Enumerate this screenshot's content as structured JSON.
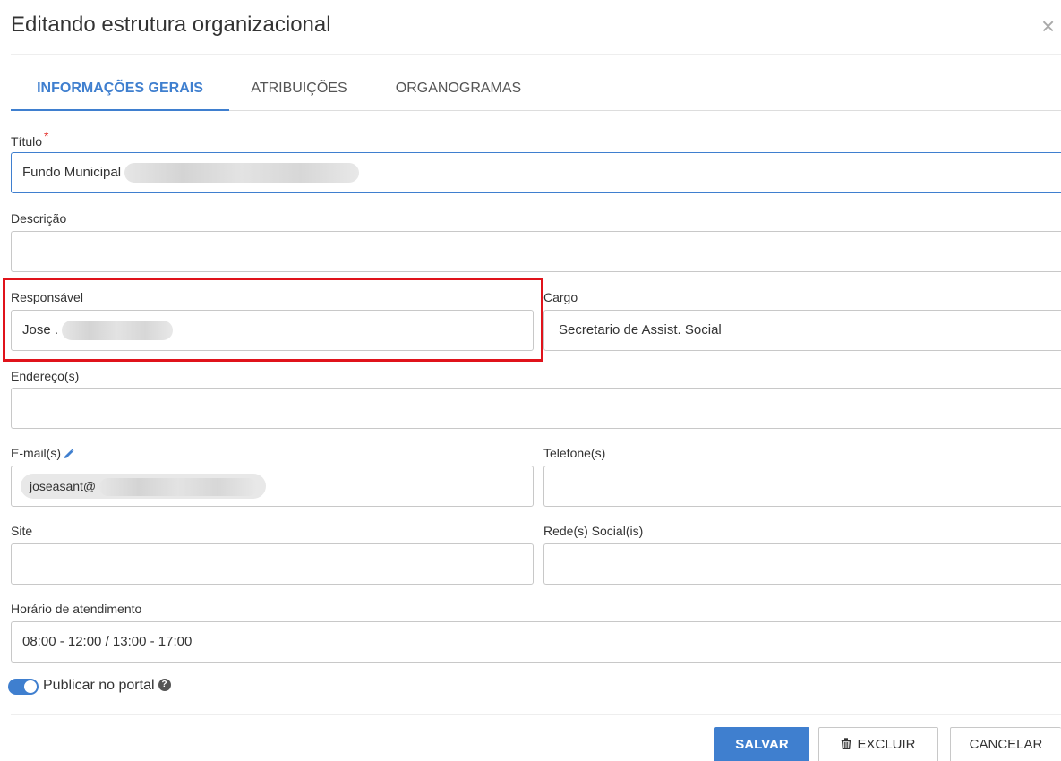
{
  "modal": {
    "title": "Editando estrutura organizacional",
    "close_symbol": "×"
  },
  "tabs": [
    {
      "label": "INFORMAÇÕES GERAIS",
      "active": true
    },
    {
      "label": "ATRIBUIÇÕES",
      "active": false
    },
    {
      "label": "ORGANOGRAMAS",
      "active": false
    }
  ],
  "form": {
    "titulo": {
      "label": "Título",
      "required_mark": "*",
      "value": "Fundo Municipal"
    },
    "descricao": {
      "label": "Descrição",
      "value": ""
    },
    "responsavel": {
      "label": "Responsável",
      "value": "Jose ."
    },
    "cargo": {
      "label": "Cargo",
      "value": "Secretario de Assist. Social"
    },
    "endereco": {
      "label": "Endereço(s)",
      "value": ""
    },
    "email": {
      "label": "E-mail(s)",
      "chip_value": "joseasant@",
      "icon": "pencil-icon"
    },
    "telefone": {
      "label": "Telefone(s)",
      "value": ""
    },
    "site": {
      "label": "Site",
      "value": ""
    },
    "rede_social": {
      "label": "Rede(s) Social(is)",
      "value": ""
    },
    "horario": {
      "label": "Horário de atendimento",
      "value": "08:00 - 12:00 / 13:00 - 17:00"
    },
    "publicar": {
      "label": "Publicar no portal",
      "enabled": true,
      "help_icon": "question-circle-icon",
      "help_symbol": "?"
    }
  },
  "buttons": {
    "save_label": "SALVAR",
    "delete_label": "EXCLUIR",
    "cancel_label": "CANCELAR"
  },
  "colors": {
    "accent": "#3f7fcf",
    "highlight_border": "#e0131b",
    "required": "#e53935"
  }
}
